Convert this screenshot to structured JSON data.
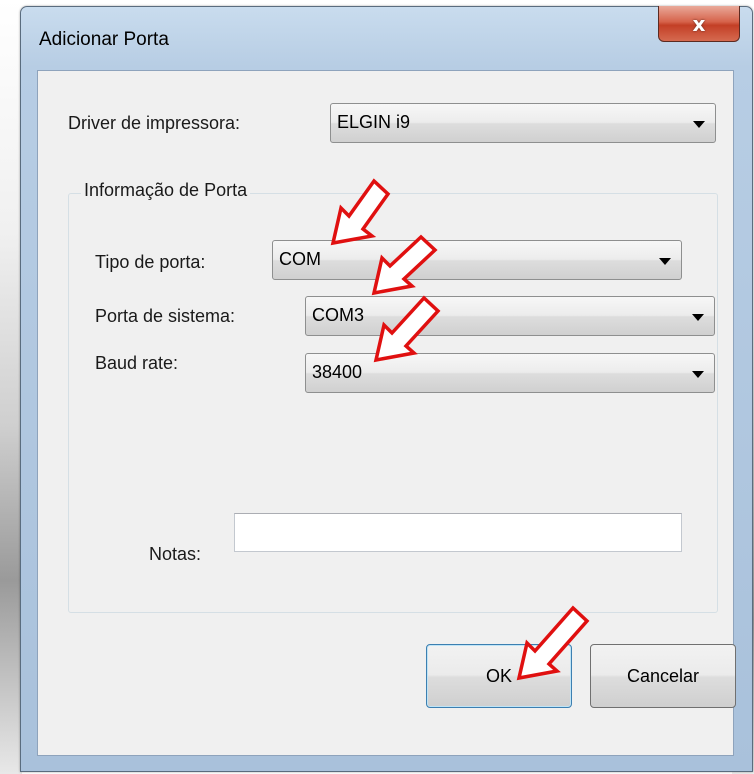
{
  "window": {
    "title": "Adicionar Porta",
    "close_symbol": "x"
  },
  "form": {
    "driver_label": "Driver de impressora:",
    "driver_value": "ELGIN i9",
    "group_title": "Informação de Porta",
    "port_type_label": "Tipo de porta:",
    "port_type_value": "COM",
    "system_port_label": "Porta de sistema:",
    "system_port_value": "COM3",
    "baud_label": "Baud rate:",
    "baud_value": "38400",
    "notes_label": "Notas:",
    "notes_value": ""
  },
  "buttons": {
    "ok_label": "OK",
    "cancel_label": "Cancelar"
  },
  "annotations": {
    "arrow_color": "#e01010",
    "arrow_icon": "red-pointer-arrow-icon"
  }
}
